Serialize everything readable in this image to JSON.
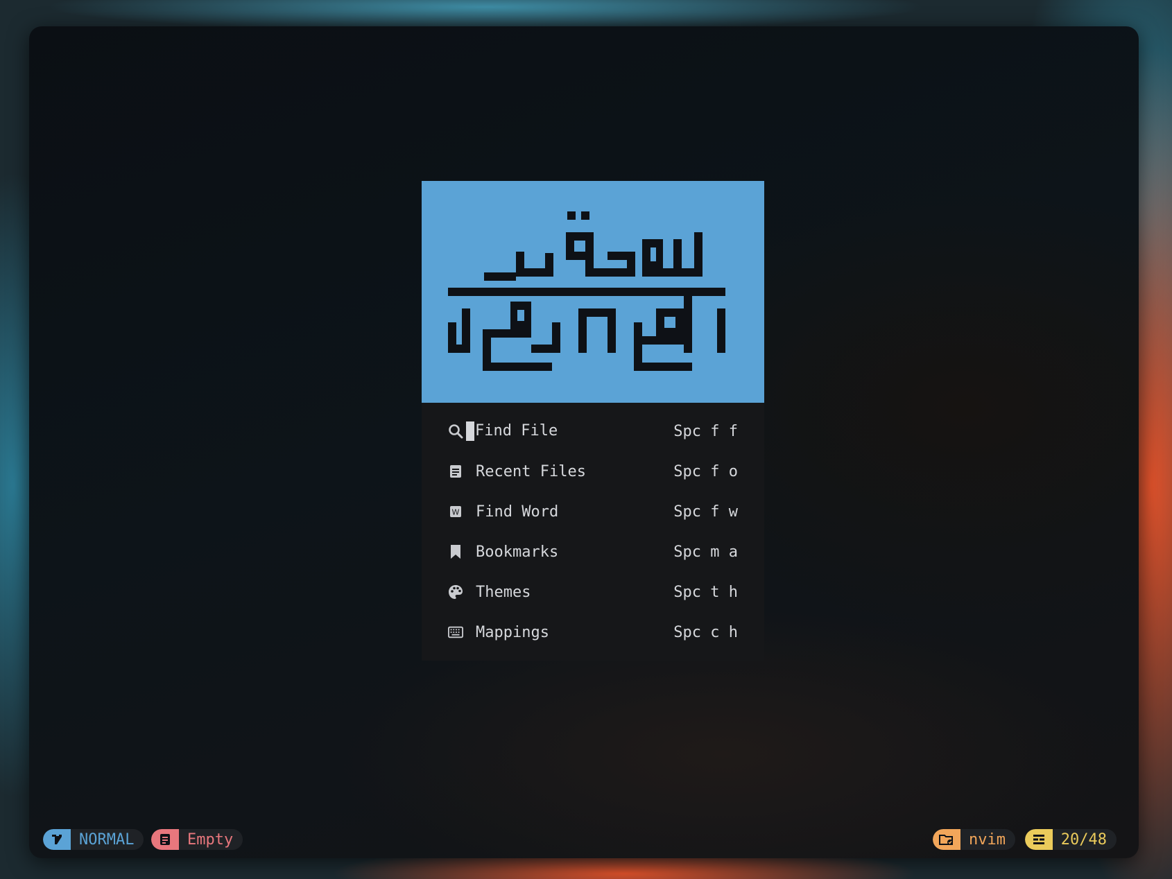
{
  "colors": {
    "accent_blue": "#5ba3d6",
    "red": "#e8777d",
    "orange": "#f2a65a",
    "yellow": "#ebcb5b",
    "menu_bg": "#161719",
    "text": "#d6d8dc"
  },
  "banner": {
    "art": "kufic-calligraphy-logo",
    "icon": "kufic-logo-icon"
  },
  "menu": [
    {
      "icon": "search-icon",
      "label": "Find File",
      "shortcut": "Spc f f"
    },
    {
      "icon": "document-icon",
      "label": "Recent Files",
      "shortcut": "Spc f o"
    },
    {
      "icon": "word-icon",
      "label": "Find Word",
      "shortcut": "Spc f w"
    },
    {
      "icon": "bookmark-icon",
      "label": "Bookmarks",
      "shortcut": "Spc m a"
    },
    {
      "icon": "palette-icon",
      "label": "Themes",
      "shortcut": "Spc t h"
    },
    {
      "icon": "keyboard-icon",
      "label": "Mappings",
      "shortcut": "Spc c h"
    }
  ],
  "statusline": {
    "mode": {
      "icon": "vim-icon",
      "text": "NORMAL"
    },
    "file": {
      "icon": "file-icon",
      "text": "Empty"
    },
    "cwd": {
      "icon": "folder-icon",
      "text": "nvim"
    },
    "position": {
      "icon": "position-icon",
      "text": "20/48"
    }
  }
}
